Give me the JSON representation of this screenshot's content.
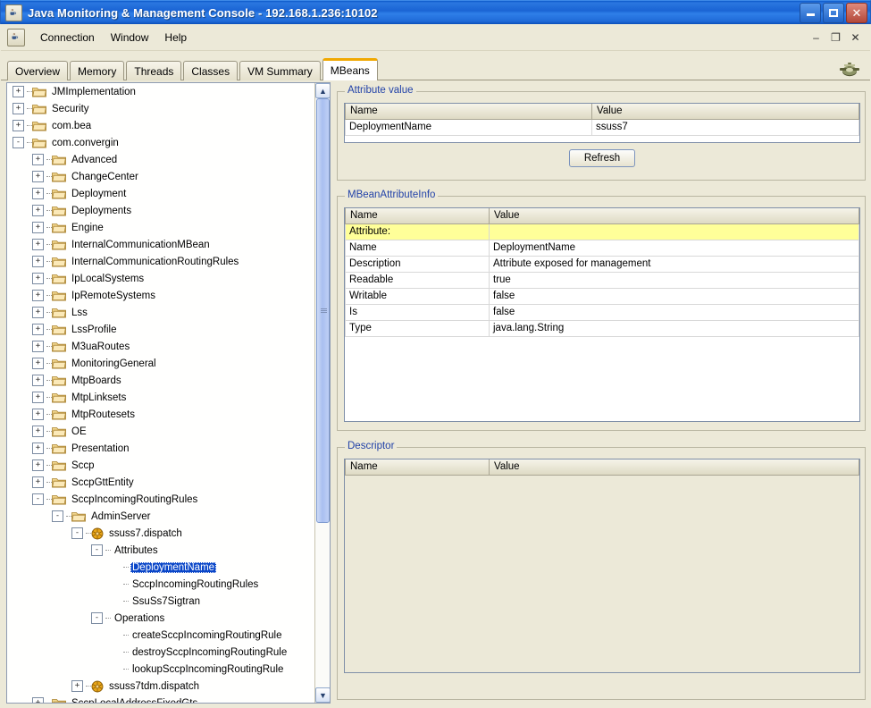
{
  "window": {
    "title": "Java Monitoring & Management Console - 192.168.1.236:10102",
    "app_icon": "java-cup-icon",
    "controls": {
      "minimize": "minimize-icon",
      "maximize": "maximize-icon",
      "close": "close-icon"
    }
  },
  "menubar": {
    "icon": "java-cup-icon",
    "items": [
      {
        "label": "Connection"
      },
      {
        "label": "Window"
      },
      {
        "label": "Help"
      }
    ],
    "frame_controls": {
      "minimize": "–",
      "restore": "❐",
      "close": "✕"
    }
  },
  "tabs": {
    "items": [
      {
        "label": "Overview",
        "active": false
      },
      {
        "label": "Memory",
        "active": false
      },
      {
        "label": "Threads",
        "active": false
      },
      {
        "label": "Classes",
        "active": false
      },
      {
        "label": "VM Summary",
        "active": false
      },
      {
        "label": "MBeans",
        "active": true
      }
    ],
    "right_icon": "connector-icon"
  },
  "tree": {
    "selected": "DeploymentName",
    "nodes": [
      {
        "label": "JMImplementation",
        "depth": 0,
        "toggle": "+",
        "icon": "folder-icon"
      },
      {
        "label": "Security",
        "depth": 0,
        "toggle": "+",
        "icon": "folder-icon"
      },
      {
        "label": "com.bea",
        "depth": 0,
        "toggle": "+",
        "icon": "folder-icon"
      },
      {
        "label": "com.convergin",
        "depth": 0,
        "toggle": "-",
        "icon": "folder-icon"
      },
      {
        "label": "Advanced",
        "depth": 1,
        "toggle": "+",
        "icon": "folder-icon"
      },
      {
        "label": "ChangeCenter",
        "depth": 1,
        "toggle": "+",
        "icon": "folder-icon"
      },
      {
        "label": "Deployment",
        "depth": 1,
        "toggle": "+",
        "icon": "folder-icon"
      },
      {
        "label": "Deployments",
        "depth": 1,
        "toggle": "+",
        "icon": "folder-icon"
      },
      {
        "label": "Engine",
        "depth": 1,
        "toggle": "+",
        "icon": "folder-icon"
      },
      {
        "label": "InternalCommunicationMBean",
        "depth": 1,
        "toggle": "+",
        "icon": "folder-icon"
      },
      {
        "label": "InternalCommunicationRoutingRules",
        "depth": 1,
        "toggle": "+",
        "icon": "folder-icon"
      },
      {
        "label": "IpLocalSystems",
        "depth": 1,
        "toggle": "+",
        "icon": "folder-icon"
      },
      {
        "label": "IpRemoteSystems",
        "depth": 1,
        "toggle": "+",
        "icon": "folder-icon"
      },
      {
        "label": "Lss",
        "depth": 1,
        "toggle": "+",
        "icon": "folder-icon"
      },
      {
        "label": "LssProfile",
        "depth": 1,
        "toggle": "+",
        "icon": "folder-icon"
      },
      {
        "label": "M3uaRoutes",
        "depth": 1,
        "toggle": "+",
        "icon": "folder-icon"
      },
      {
        "label": "MonitoringGeneral",
        "depth": 1,
        "toggle": "+",
        "icon": "folder-icon"
      },
      {
        "label": "MtpBoards",
        "depth": 1,
        "toggle": "+",
        "icon": "folder-icon"
      },
      {
        "label": "MtpLinksets",
        "depth": 1,
        "toggle": "+",
        "icon": "folder-icon"
      },
      {
        "label": "MtpRoutesets",
        "depth": 1,
        "toggle": "+",
        "icon": "folder-icon"
      },
      {
        "label": "OE",
        "depth": 1,
        "toggle": "+",
        "icon": "folder-icon"
      },
      {
        "label": "Presentation",
        "depth": 1,
        "toggle": "+",
        "icon": "folder-icon"
      },
      {
        "label": "Sccp",
        "depth": 1,
        "toggle": "+",
        "icon": "folder-icon"
      },
      {
        "label": "SccpGttEntity",
        "depth": 1,
        "toggle": "+",
        "icon": "folder-icon"
      },
      {
        "label": "SccpIncomingRoutingRules",
        "depth": 1,
        "toggle": "-",
        "icon": "folder-icon"
      },
      {
        "label": "AdminServer",
        "depth": 2,
        "toggle": "-",
        "icon": "folder-icon"
      },
      {
        "label": "ssuss7.dispatch",
        "depth": 3,
        "toggle": "-",
        "icon": "mbean-icon"
      },
      {
        "label": "Attributes",
        "depth": 4,
        "toggle": "-",
        "icon": "none"
      },
      {
        "label": "DeploymentName",
        "depth": 5,
        "toggle": "",
        "icon": "none",
        "selected": true
      },
      {
        "label": "SccpIncomingRoutingRules",
        "depth": 5,
        "toggle": "",
        "icon": "none"
      },
      {
        "label": "SsuSs7Sigtran",
        "depth": 5,
        "toggle": "",
        "icon": "none"
      },
      {
        "label": "Operations",
        "depth": 4,
        "toggle": "-",
        "icon": "none"
      },
      {
        "label": "createSccpIncomingRoutingRule",
        "depth": 5,
        "toggle": "",
        "icon": "none"
      },
      {
        "label": "destroySccpIncomingRoutingRule",
        "depth": 5,
        "toggle": "",
        "icon": "none"
      },
      {
        "label": "lookupSccpIncomingRoutingRule",
        "depth": 5,
        "toggle": "",
        "icon": "none"
      },
      {
        "label": "ssuss7tdm.dispatch",
        "depth": 3,
        "toggle": "+",
        "icon": "mbean-icon"
      },
      {
        "label": "SccpLocalAddressFixedGts",
        "depth": 1,
        "toggle": "+",
        "icon": "folder-icon"
      }
    ]
  },
  "attribute_value": {
    "title": "Attribute value",
    "columns": [
      "Name",
      "Value"
    ],
    "rows": [
      {
        "name": "DeploymentName",
        "value": "ssuss7"
      }
    ],
    "refresh_label": "Refresh"
  },
  "mbean_attribute_info": {
    "title": "MBeanAttributeInfo",
    "columns": [
      "Name",
      "Value"
    ],
    "rows": [
      {
        "name": "Attribute:",
        "value": "",
        "highlight": true
      },
      {
        "name": "Name",
        "value": "DeploymentName",
        "highlight": false
      },
      {
        "name": "Description",
        "value": "Attribute exposed for management",
        "highlight": false
      },
      {
        "name": "Readable",
        "value": "true",
        "highlight": false
      },
      {
        "name": "Writable",
        "value": "false",
        "highlight": false
      },
      {
        "name": "Is",
        "value": "false",
        "highlight": false
      },
      {
        "name": "Type",
        "value": "java.lang.String",
        "highlight": false
      }
    ]
  },
  "descriptor": {
    "title": "Descriptor",
    "columns": [
      "Name",
      "Value"
    ],
    "rows": []
  },
  "colors": {
    "titlebar_blue": "#1f63c8",
    "panel_bg": "#ece9d8",
    "group_title": "#2242a8",
    "selection_blue": "#0a46c8",
    "highlight_yellow": "#ffff99",
    "active_tab_accent": "#f0a800"
  }
}
